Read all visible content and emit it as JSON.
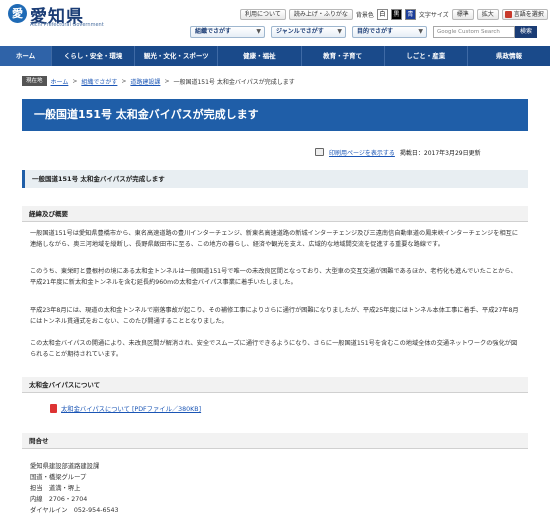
{
  "header": {
    "logo_text": "愛知県",
    "logo_sub": "Aichi Prefectural Government",
    "buttons": [
      "利用について",
      "読み上げ・ふりがな"
    ],
    "bg_label": "背景色",
    "colors": [
      "白",
      "黒",
      "青"
    ],
    "fontsize_label": "文字サイズ",
    "fontsize_buttons": [
      "標準",
      "拡大"
    ],
    "lang_label": "言語を選択",
    "dropdowns": [
      "組織でさがす",
      "ジャンルでさがす",
      "目的でさがす"
    ],
    "search_placeholder": "Google Custom Search",
    "search_button": "検索"
  },
  "nav": {
    "items": [
      "ホーム",
      "くらし・安全・環境",
      "観光・文化・スポーツ",
      "健康・福祉",
      "教育・子育て",
      "しごと・産業",
      "県政情報"
    ]
  },
  "breadcrumb": {
    "here": "現在地",
    "links": [
      "ホーム",
      "組織でさがす",
      "道路建設課"
    ],
    "current": "一般国道151号 太和金バイパスが完成します"
  },
  "page": {
    "title": "一般国道151号 太和金バイパスが完成します",
    "print_label": "印刷用ページを表示する",
    "date": "掲載日：2017年3月29日更新"
  },
  "sections": {
    "main_head": "一般国道151号 太和金バイパスが完成します",
    "summary_head": "経緯及び概要",
    "para1": "一般国道151号は愛知県豊橋市から、東名高速道路の豊川インターチェンジ、新東名高速道路の新城インターチェンジ及び三遠南信自動車道の鳳来峡インターチェンジを相互に連絡しながら、奥三河地域を縦断し、長野県飯田市に至る、この地方の暮らし、経済や観光を支え、広域的な地域間交流を促進する重要な路線です。",
    "para2": "このうち、東栄町と豊根村の境にある太和金トンネルは一般国道151号で唯一の未改良区間となっており、大型車の交互交通が困難であるほか、老朽化も進んでいたことから、平成21年度に新太和金トンネルを含む延長約960mの太和金バイパス事業に着手いたしました。",
    "para3": "平成23年8月には、現道の太和金トンネルで崩落事故が起こり、その補修工事によりさらに通行が困難になりましたが、平成25年度にはトンネル本体工事に着手、平成27年8月にはトンネル貫通式をおこない、このたび開通することとなりました。",
    "para4": "この太和金バイパスの開通により、未改良区間が解消され、安全でスムーズに通行できるようになり、さらに一般国道151号を含むこの地域全体の交通ネットワークの強化が図られることが期待されています。",
    "bypass_head": "太和金バイパスについて",
    "pdf_link": "太和金バイパスについて [PDFファイル／380KB]",
    "contact_head": "問合せ",
    "contact_lines": [
      "愛知県建設部道路建設課",
      "国道・橋梁グループ",
      "担当　道満・堺上",
      "内線　2706・2704",
      "ダイヤルイン　052-954-6543"
    ]
  },
  "colors": {
    "brand_blue": "#1f5ea8",
    "nav_blue": "#1a4a8a",
    "link": "#1a55b5"
  }
}
